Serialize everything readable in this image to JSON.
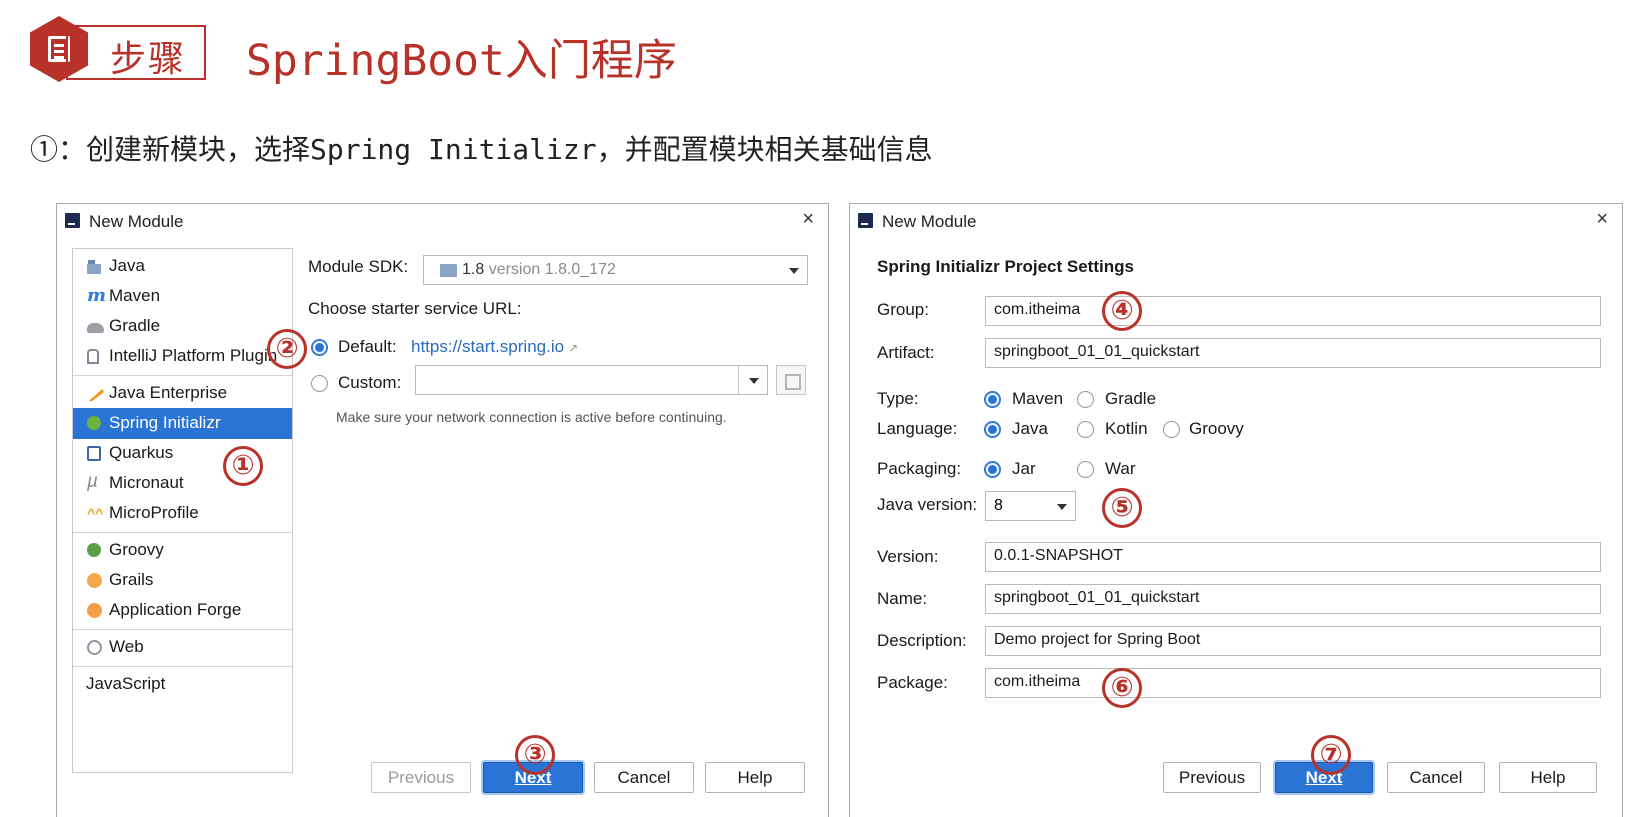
{
  "slide": {
    "step_label": "步骤",
    "title": "SpringBoot入门程序",
    "subtitle": "①：创建新模块，选择Spring Initializr，并配置模块相关基础信息"
  },
  "left_dialog": {
    "title": "New Module",
    "close": "×",
    "generators": [
      {
        "label": "Java",
        "icon": "java-folder-icon"
      },
      {
        "label": "Maven",
        "icon": "maven-icon"
      },
      {
        "label": "Gradle",
        "icon": "gradle-icon"
      },
      {
        "label": "IntelliJ Platform Plugin",
        "icon": "plugin-icon"
      },
      {
        "label": "Java Enterprise",
        "icon": "enterprise-icon"
      },
      {
        "label": "Spring Initializr",
        "icon": "spring-icon",
        "selected": true
      },
      {
        "label": "Quarkus",
        "icon": "quarkus-icon"
      },
      {
        "label": "Micronaut",
        "icon": "micronaut-icon"
      },
      {
        "label": "MicroProfile",
        "icon": "microprofile-icon"
      },
      {
        "label": "Groovy",
        "icon": "groovy-icon"
      },
      {
        "label": "Grails",
        "icon": "grails-icon"
      },
      {
        "label": "Application Forge",
        "icon": "forge-icon"
      },
      {
        "label": "Web",
        "icon": "web-icon"
      },
      {
        "label": "JavaScript",
        "icon": ""
      }
    ],
    "module_sdk_label": "Module SDK:",
    "module_sdk_value": "1.8",
    "module_sdk_version": "version 1.8.0_172",
    "starter_url_label": "Choose starter service URL:",
    "default_label": "Default:",
    "default_url": "https://start.spring.io",
    "custom_label": "Custom:",
    "custom_value": "",
    "hint": "Make sure your network connection is active before continuing.",
    "buttons": {
      "previous": "Previous",
      "next": "Next",
      "cancel": "Cancel",
      "help": "Help"
    }
  },
  "right_dialog": {
    "title": "New Module",
    "close": "×",
    "section_title": "Spring Initializr Project Settings",
    "group_label": "Group:",
    "group_value": "com.itheima",
    "artifact_label": "Artifact:",
    "artifact_value": "springboot_01_01_quickstart",
    "type_label": "Type:",
    "type_options": [
      "Maven",
      "Gradle"
    ],
    "type_selected": "Maven",
    "language_label": "Language:",
    "language_options": [
      "Java",
      "Kotlin",
      "Groovy"
    ],
    "language_selected": "Java",
    "packaging_label": "Packaging:",
    "packaging_options": [
      "Jar",
      "War"
    ],
    "packaging_selected": "Jar",
    "java_version_label": "Java version:",
    "java_version_value": "8",
    "version_label": "Version:",
    "version_value": "0.0.1-SNAPSHOT",
    "name_label": "Name:",
    "name_value": "springboot_01_01_quickstart",
    "description_label": "Description:",
    "description_value": "Demo project for Spring Boot",
    "package_label": "Package:",
    "package_value": "com.itheima",
    "buttons": {
      "previous": "Previous",
      "next": "Next",
      "cancel": "Cancel",
      "help": "Help"
    }
  },
  "markers": [
    "①",
    "②",
    "③",
    "④",
    "⑤",
    "⑥",
    "⑦"
  ],
  "colors": {
    "accent_red": "#b8322a",
    "selection_blue": "#2a74d6",
    "link_blue": "#2a6bbf"
  }
}
